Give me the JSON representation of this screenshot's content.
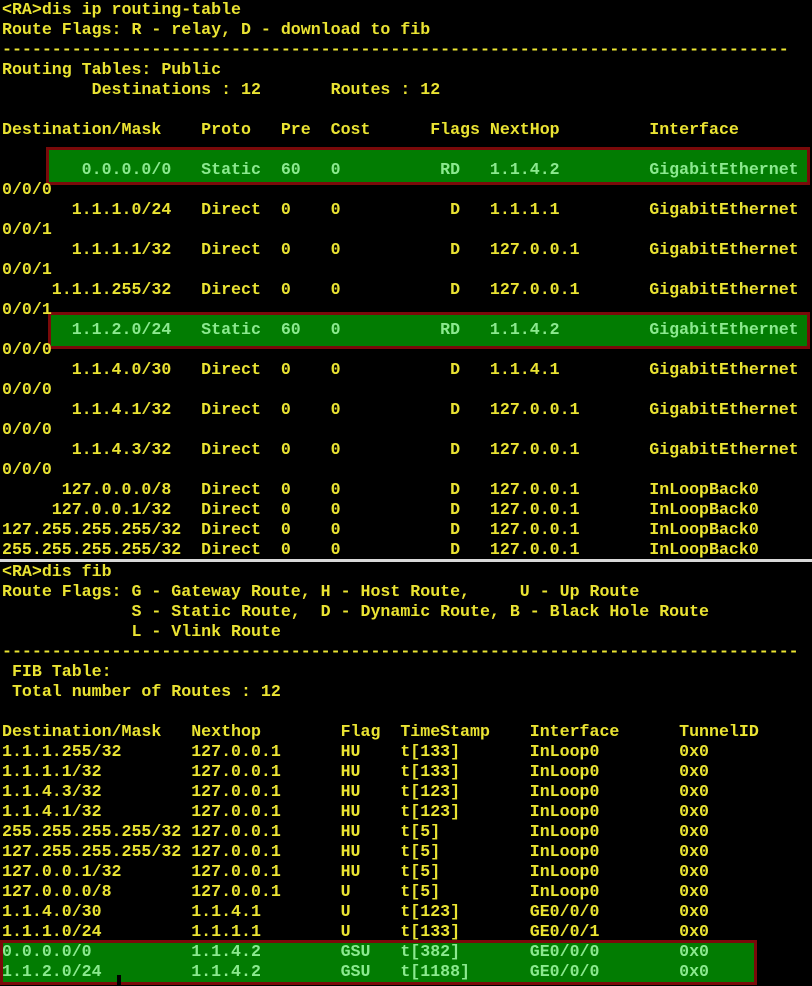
{
  "colors": {
    "background": "#000000",
    "terminal_text": "#eae332",
    "highlight_fill": "#027c02",
    "highlight_border": "#7a0a0a",
    "highlight_text": "#8be98f",
    "section_separator": "#d8d8d8"
  },
  "top_section": {
    "command": "<RA>dis ip routing-table",
    "route_flags_legend": "Route Flags: R - relay, D - download to fib",
    "separator": "-------------------------------------------------------------------------------",
    "table_title": "Routing Tables: Public",
    "destinations_label": "Destinations : 12",
    "routes_label": "Routes : 12",
    "headers": [
      "Destination/Mask",
      "Proto",
      "Pre",
      "Cost",
      "Flags",
      "NextHop",
      "Interface"
    ],
    "routes": [
      {
        "dest": "0.0.0.0/0",
        "proto": "Static",
        "pre": "60",
        "cost": "0",
        "flags": "RD",
        "nexthop": "1.1.4.2",
        "interface": "GigabitEthernet0/0/0",
        "highlight": true
      },
      {
        "dest": "1.1.1.0/24",
        "proto": "Direct",
        "pre": "0",
        "cost": "0",
        "flags": "D",
        "nexthop": "1.1.1.1",
        "interface": "GigabitEthernet0/0/1",
        "highlight": false
      },
      {
        "dest": "1.1.1.1/32",
        "proto": "Direct",
        "pre": "0",
        "cost": "0",
        "flags": "D",
        "nexthop": "127.0.0.1",
        "interface": "GigabitEthernet0/0/1",
        "highlight": false
      },
      {
        "dest": "1.1.1.255/32",
        "proto": "Direct",
        "pre": "0",
        "cost": "0",
        "flags": "D",
        "nexthop": "127.0.0.1",
        "interface": "GigabitEthernet0/0/1",
        "highlight": false
      },
      {
        "dest": "1.1.2.0/24",
        "proto": "Static",
        "pre": "60",
        "cost": "0",
        "flags": "RD",
        "nexthop": "1.1.4.2",
        "interface": "GigabitEthernet0/0/0",
        "highlight": true
      },
      {
        "dest": "1.1.4.0/30",
        "proto": "Direct",
        "pre": "0",
        "cost": "0",
        "flags": "D",
        "nexthop": "1.1.4.1",
        "interface": "GigabitEthernet0/0/0",
        "highlight": false
      },
      {
        "dest": "1.1.4.1/32",
        "proto": "Direct",
        "pre": "0",
        "cost": "0",
        "flags": "D",
        "nexthop": "127.0.0.1",
        "interface": "GigabitEthernet0/0/0",
        "highlight": false
      },
      {
        "dest": "1.1.4.3/32",
        "proto": "Direct",
        "pre": "0",
        "cost": "0",
        "flags": "D",
        "nexthop": "127.0.0.1",
        "interface": "GigabitEthernet0/0/0",
        "highlight": false
      },
      {
        "dest": "127.0.0.0/8",
        "proto": "Direct",
        "pre": "0",
        "cost": "0",
        "flags": "D",
        "nexthop": "127.0.0.1",
        "interface": "InLoopBack0",
        "highlight": false
      },
      {
        "dest": "127.0.0.1/32",
        "proto": "Direct",
        "pre": "0",
        "cost": "0",
        "flags": "D",
        "nexthop": "127.0.0.1",
        "interface": "InLoopBack0",
        "highlight": false
      },
      {
        "dest": "127.255.255.255/32",
        "proto": "Direct",
        "pre": "0",
        "cost": "0",
        "flags": "D",
        "nexthop": "127.0.0.1",
        "interface": "InLoopBack0",
        "highlight": false
      },
      {
        "dest": "255.255.255.255/32",
        "proto": "Direct",
        "pre": "0",
        "cost": "0",
        "flags": "D",
        "nexthop": "127.0.0.1",
        "interface": "InLoopBack0",
        "highlight": false
      }
    ]
  },
  "bottom_section": {
    "command": "<RA>dis fib",
    "route_flags_legend_lines": [
      "Route Flags: G - Gateway Route, H - Host Route,     U - Up Route",
      "             S - Static Route,  D - Dynamic Route, B - Black Hole Route",
      "             L - Vlink Route"
    ],
    "separator": "--------------------------------------------------------------------------------",
    "fib_table_label": " FIB Table:",
    "total_routes_label": " Total number of Routes : 12",
    "headers": [
      "Destination/Mask",
      "Nexthop",
      "Flag",
      "TimeStamp",
      "Interface",
      "TunnelID"
    ],
    "fib_entries": [
      {
        "dest": "1.1.1.255/32",
        "nexthop": "127.0.0.1",
        "flag": "HU",
        "timestamp": "t[133]",
        "interface": "InLoop0",
        "tunnel_id": "0x0",
        "highlight": false
      },
      {
        "dest": "1.1.1.1/32",
        "nexthop": "127.0.0.1",
        "flag": "HU",
        "timestamp": "t[133]",
        "interface": "InLoop0",
        "tunnel_id": "0x0",
        "highlight": false
      },
      {
        "dest": "1.1.4.3/32",
        "nexthop": "127.0.0.1",
        "flag": "HU",
        "timestamp": "t[123]",
        "interface": "InLoop0",
        "tunnel_id": "0x0",
        "highlight": false
      },
      {
        "dest": "1.1.4.1/32",
        "nexthop": "127.0.0.1",
        "flag": "HU",
        "timestamp": "t[123]",
        "interface": "InLoop0",
        "tunnel_id": "0x0",
        "highlight": false
      },
      {
        "dest": "255.255.255.255/32",
        "nexthop": "127.0.0.1",
        "flag": "HU",
        "timestamp": "t[5]",
        "interface": "InLoop0",
        "tunnel_id": "0x0",
        "highlight": false
      },
      {
        "dest": "127.255.255.255/32",
        "nexthop": "127.0.0.1",
        "flag": "HU",
        "timestamp": "t[5]",
        "interface": "InLoop0",
        "tunnel_id": "0x0",
        "highlight": false
      },
      {
        "dest": "127.0.0.1/32",
        "nexthop": "127.0.0.1",
        "flag": "HU",
        "timestamp": "t[5]",
        "interface": "InLoop0",
        "tunnel_id": "0x0",
        "highlight": false
      },
      {
        "dest": "127.0.0.0/8",
        "nexthop": "127.0.0.1",
        "flag": "U",
        "timestamp": "t[5]",
        "interface": "InLoop0",
        "tunnel_id": "0x0",
        "highlight": false
      },
      {
        "dest": "1.1.4.0/30",
        "nexthop": "1.1.4.1",
        "flag": "U",
        "timestamp": "t[123]",
        "interface": "GE0/0/0",
        "tunnel_id": "0x0",
        "highlight": false
      },
      {
        "dest": "1.1.1.0/24",
        "nexthop": "1.1.1.1",
        "flag": "U",
        "timestamp": "t[133]",
        "interface": "GE0/0/1",
        "tunnel_id": "0x0",
        "highlight": false
      },
      {
        "dest": "0.0.0.0/0",
        "nexthop": "1.1.4.2",
        "flag": "GSU",
        "timestamp": "t[382]",
        "interface": "GE0/0/0",
        "tunnel_id": "0x0",
        "highlight": true
      },
      {
        "dest": "1.1.2.0/24",
        "nexthop": "1.1.4.2",
        "flag": "GSU",
        "timestamp": "t[1188]",
        "interface": "GE0/0/0",
        "tunnel_id": "0x0",
        "highlight": true
      }
    ]
  }
}
